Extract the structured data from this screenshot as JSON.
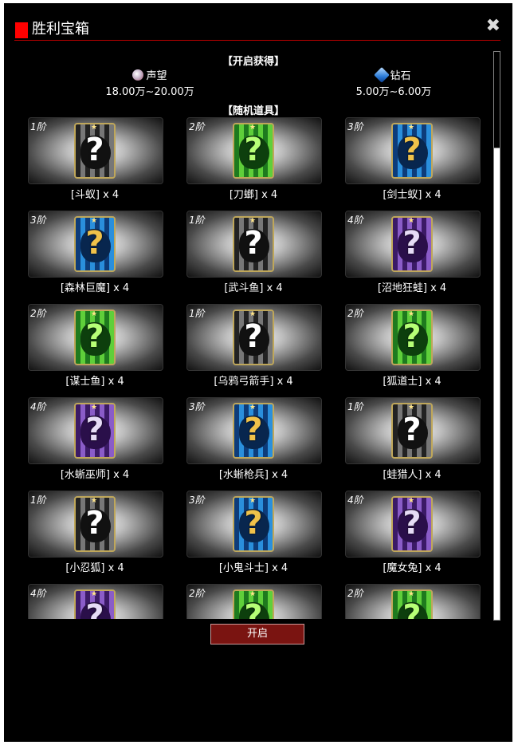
{
  "title": "胜利宝箱",
  "close_icon": "close-icon",
  "rewards_header": "【开启获得】",
  "rewards": [
    {
      "icon": "reputation-icon",
      "name": "声望",
      "value": "18.00万~20.00万"
    },
    {
      "icon": "diamond-icon",
      "name": "钻石",
      "value": "5.00万~6.00万"
    }
  ],
  "random_header": "【随机道具】",
  "items": [
    {
      "tier": "1阶",
      "name": "[斗蚁] x 4",
      "rarity": "grey"
    },
    {
      "tier": "2阶",
      "name": "[刀螂] x 4",
      "rarity": "green"
    },
    {
      "tier": "3阶",
      "name": "[剑士蚁] x 4",
      "rarity": "blue"
    },
    {
      "tier": "3阶",
      "name": "[森林巨魔] x 4",
      "rarity": "blue"
    },
    {
      "tier": "1阶",
      "name": "[武斗鱼] x 4",
      "rarity": "grey"
    },
    {
      "tier": "4阶",
      "name": "[沼地狂蛙] x 4",
      "rarity": "purple"
    },
    {
      "tier": "2阶",
      "name": "[谋士鱼] x 4",
      "rarity": "green"
    },
    {
      "tier": "1阶",
      "name": "[乌鸦弓箭手] x 4",
      "rarity": "grey"
    },
    {
      "tier": "2阶",
      "name": "[狐道士] x 4",
      "rarity": "green"
    },
    {
      "tier": "4阶",
      "name": "[水蜥巫师] x 4",
      "rarity": "purple"
    },
    {
      "tier": "3阶",
      "name": "[水蜥枪兵] x 4",
      "rarity": "blue"
    },
    {
      "tier": "1阶",
      "name": "[蛙猎人] x 4",
      "rarity": "grey"
    },
    {
      "tier": "1阶",
      "name": "[小忍狐] x 4",
      "rarity": "grey"
    },
    {
      "tier": "3阶",
      "name": "[小鬼斗士] x 4",
      "rarity": "blue"
    },
    {
      "tier": "4阶",
      "name": "[魔女兔] x 4",
      "rarity": "purple"
    },
    {
      "tier": "4阶",
      "name": "",
      "rarity": "purple"
    },
    {
      "tier": "2阶",
      "name": "",
      "rarity": "green"
    },
    {
      "tier": "2阶",
      "name": "",
      "rarity": "green"
    }
  ],
  "open_button": "开启"
}
